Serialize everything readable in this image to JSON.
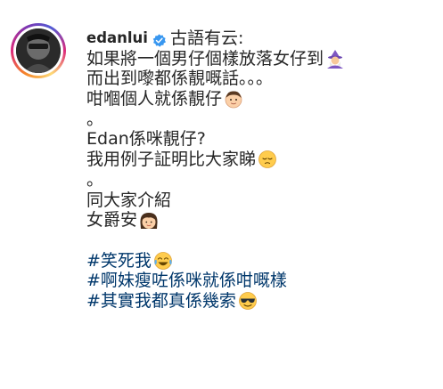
{
  "post": {
    "username": "edanlui",
    "verified_icon": "verified-badge-icon",
    "accent_color": "#3897f0",
    "hashtag_color": "#00376b",
    "lines": [
      "古語有云:",
      "如果將一個男仔個樣放落女仔到",
      "而出到嚟都係靚嘅話。。。",
      "咁嗰個人就係靚仔",
      "。",
      "Edan係咪靚仔?",
      "我用例子証明比大家睇",
      "。",
      "同大家介紹",
      "女爵安"
    ],
    "hashtags": [
      "#笑死我",
      "#啊妹瘦咗係咪就係咁嘅樣",
      "#其實我都真係幾索"
    ],
    "emojis": {
      "line2": "wizard-emoji-icon",
      "line4": "boy-face-emoji-icon",
      "line7": "pensive-face-emoji-icon",
      "line10": "girl-face-emoji-icon",
      "tag1": "tears-of-joy-emoji-icon",
      "tag3": "sunglasses-face-emoji-icon"
    }
  }
}
